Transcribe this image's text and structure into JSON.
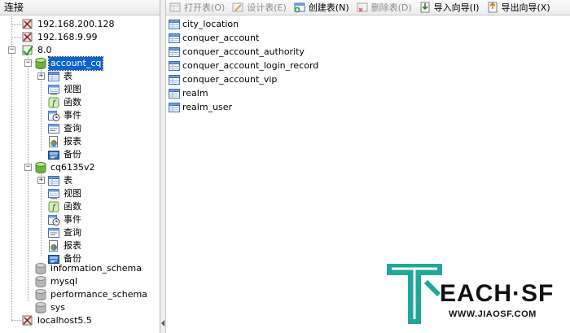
{
  "left_panel": {
    "title": "连接"
  },
  "tree": {
    "conn1": "192.168.200.128",
    "conn2": "192.168.9.99",
    "conn3": "8.0",
    "db1": {
      "name": "account_cq",
      "children": [
        "表",
        "视图",
        "函数",
        "事件",
        "查询",
        "报表",
        "备份"
      ]
    },
    "db2": {
      "name": "cq6135v2",
      "children": [
        "表",
        "视图",
        "函数",
        "事件",
        "查询",
        "报表",
        "备份"
      ]
    },
    "db3": "information_schema",
    "db4": "mysql",
    "db5": "performance_schema",
    "db6": "sys",
    "conn4": "localhost5.5"
  },
  "toolbar": {
    "open_table": "打开表(O)",
    "design_table": "设计表(E)",
    "create_table": "创建表(N)",
    "delete_table": "删除表(D)",
    "import_wizard": "导入向导(I)",
    "export_wizard": "导出向导(X)"
  },
  "tables": [
    "city_location",
    "conquer_account",
    "conquer_account_authority",
    "conquer_account_login_record",
    "conquer_account_vip",
    "realm",
    "realm_user"
  ],
  "watermark": {
    "text": "EACH·SF",
    "url": "WWW.JIAOSF.COM"
  },
  "colors": {
    "selection": "#0a64d6",
    "watermark_teal": "#1fa89a",
    "db_green": "#6db33f"
  }
}
